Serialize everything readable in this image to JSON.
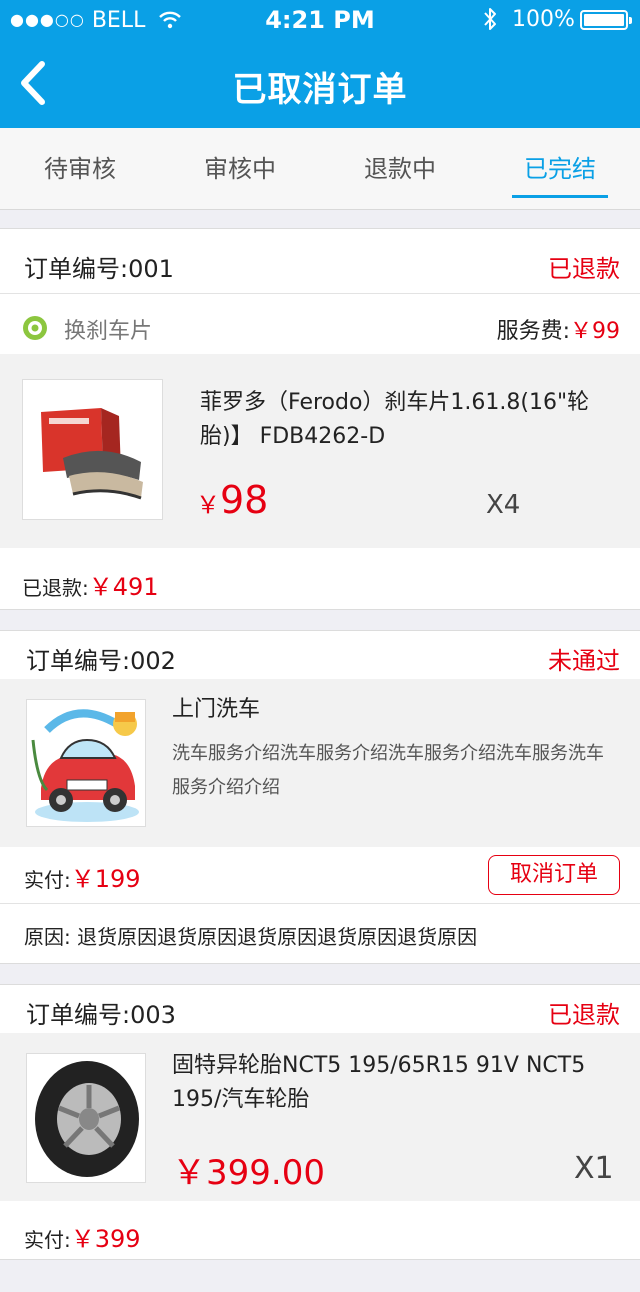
{
  "status_bar": {
    "carrier": "BELL",
    "time": "4:21 PM",
    "battery": "100%",
    "battery_level": 1.0
  },
  "nav": {
    "title": "已取消订单"
  },
  "tabs": [
    {
      "label": "待审核",
      "active": false
    },
    {
      "label": "审核中",
      "active": false
    },
    {
      "label": "退款中",
      "active": false
    },
    {
      "label": "已完结",
      "active": true
    }
  ],
  "orders": [
    {
      "order_label": "订单编号:",
      "order_no": "001",
      "status": "已退款",
      "service_name": "换刹车片",
      "service_fee_label": "服务费:",
      "service_fee": "￥99",
      "product_title": "菲罗多（Ferodo）刹车片1.61.8(16\"轮胎)】 FDB4262-D",
      "price": "98",
      "price_symbol": "￥",
      "qty": "X4",
      "summary_label": "已退款:",
      "summary_value": "￥491"
    },
    {
      "order_label": "订单编号:",
      "order_no": "002",
      "status": "未通过",
      "product_title": "上门洗车",
      "product_desc": "洗车服务介绍洗车服务介绍洗车服务介绍洗车服务洗车服务介绍介绍",
      "summary_label": "实付:",
      "summary_value": "￥199",
      "cancel_button": "取消订单",
      "reason_label": "原因:",
      "reason": "退货原因退货原因退货原因退货原因退货原因"
    },
    {
      "order_label": "订单编号:",
      "order_no": "003",
      "status": "已退款",
      "product_title": "固特异轮胎NCT5 195/65R15 91V NCT5 195/汽车轮胎",
      "price": "￥399.00",
      "qty": "X1",
      "summary_label": "实付:",
      "summary_value": "￥399"
    }
  ],
  "colors": {
    "accent": "#0aa0e6",
    "price_red": "#e60012",
    "background": "#efeff4"
  }
}
